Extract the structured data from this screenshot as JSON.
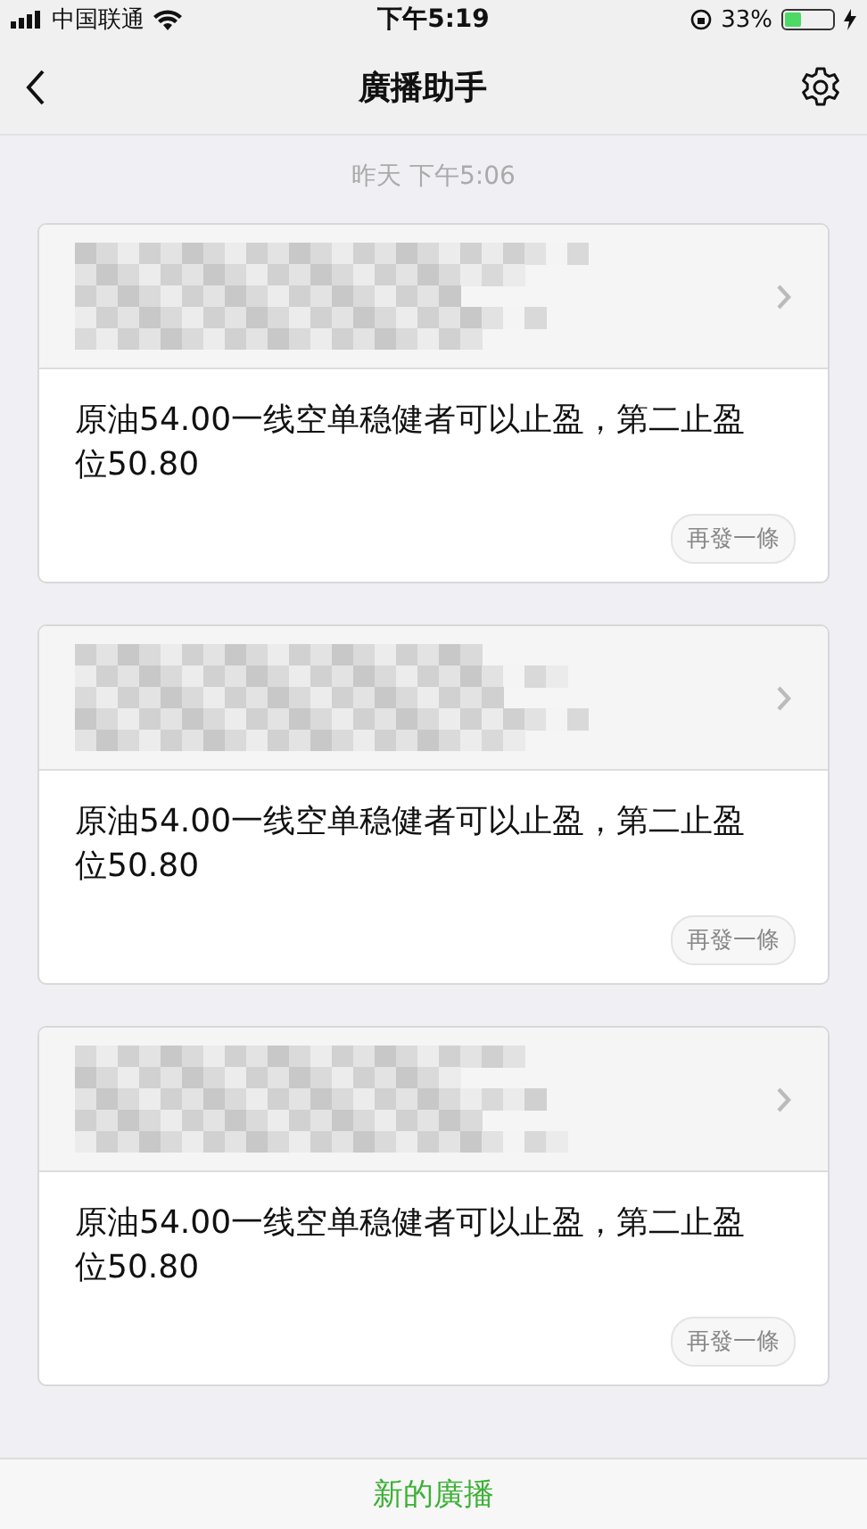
{
  "status_bar": {
    "carrier": "中国联通",
    "time": "下午5:19",
    "battery_percent": "33%",
    "battery": {
      "level": 0.33
    }
  },
  "nav": {
    "title": "廣播助手"
  },
  "timestamp": "昨天 下午5:06",
  "messages": [
    {
      "text": "原油54.00一线空单稳健者可以止盈，第二止盈位50.80",
      "resend": "再發一條"
    },
    {
      "text": "原油54.00一线空单稳健者可以止盈，第二止盈位50.80",
      "resend": "再發一條"
    },
    {
      "text": "原油54.00一线空单稳健者可以止盈，第二止盈位50.80",
      "resend": "再發一條"
    }
  ],
  "new_broadcast": "新的廣播"
}
